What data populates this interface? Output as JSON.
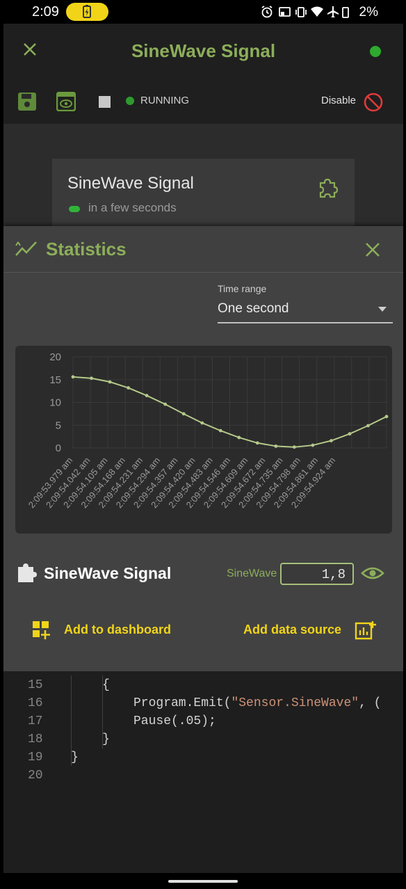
{
  "status_bar": {
    "time": "2:09",
    "icons": [
      "alarm-icon",
      "cast-icon",
      "vibrate-icon",
      "wifi-icon",
      "airplane-icon",
      "battery-icon"
    ],
    "battery_pct": "2%"
  },
  "appbar": {
    "title": "SineWave Signal"
  },
  "toolbar": {
    "status": "RUNNING",
    "disable_label": "Disable"
  },
  "node": {
    "title": "SineWave Signal",
    "subtitle": "in a few seconds"
  },
  "stats": {
    "title": "Statistics",
    "time_range_label": "Time range",
    "time_range_value": "One second",
    "signal_name": "SineWave Signal",
    "sine_label": "SineWave",
    "sine_value": "1,8",
    "add_dashboard": "Add to dashboard",
    "add_source": "Add data source"
  },
  "chart_data": {
    "type": "line",
    "title": "",
    "ylim": [
      0,
      20
    ],
    "yticks": [
      0,
      5,
      10,
      15,
      20
    ],
    "x": [
      "2:09:53.979 am",
      "2:09:54.042 am",
      "2:09:54.105 am",
      "2:09:54.168 am",
      "2:09:54.231 am",
      "2:09:54.294 am",
      "2:09:54.357 am",
      "2:09:54.420 am",
      "2:09:54.483 am",
      "2:09:54.546 am",
      "2:09:54.609 am",
      "2:09:54.672 am",
      "2:09:54.735 am",
      "2:09:54.798 am",
      "2:09:54.861 am",
      "2:09:54.924 am"
    ],
    "series": [
      {
        "values": [
          15.6,
          15.3,
          14.5,
          13.2,
          11.5,
          9.6,
          7.5,
          5.5,
          3.8,
          2.3,
          1.1,
          0.4,
          0.2,
          0.6,
          1.6,
          3.1,
          4.9,
          6.9
        ]
      }
    ],
    "grid": true,
    "color": "#b5c98a"
  },
  "code": {
    "lines": [
      {
        "n": "15",
        "indent": 2,
        "text": "{"
      },
      {
        "n": "16",
        "indent": 3,
        "text": "Program.Emit(",
        "str": "\"Sensor.SineWave\"",
        "tail": ", ("
      },
      {
        "n": "17",
        "indent": 3,
        "text": "Pause(.05);"
      },
      {
        "n": "18",
        "indent": 2,
        "text": "}"
      },
      {
        "n": "19",
        "indent": 1,
        "text": "}"
      },
      {
        "n": "20",
        "indent": 0,
        "text": ""
      }
    ]
  }
}
